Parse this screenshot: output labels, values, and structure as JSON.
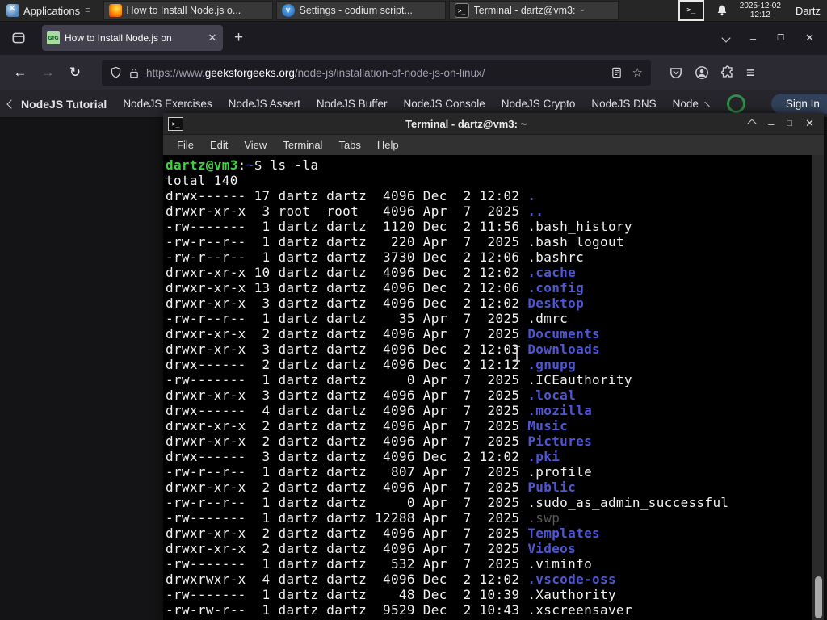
{
  "panel": {
    "applications_label": "Applications",
    "windows": [
      {
        "label": "How to Install Node.js o...",
        "icon": "firefox"
      },
      {
        "label": "Settings - codium script...",
        "icon": "codium"
      },
      {
        "label": "Terminal - dartz@vm3: ~",
        "icon": "terminal"
      }
    ],
    "tray_icons": [
      "terminal-tray-icon",
      "notification-bell-icon"
    ],
    "clock_date": "2025-12-02",
    "clock_time": "12:12",
    "user": "Dartz"
  },
  "browser": {
    "tab": {
      "title": "How to Install Node.js on",
      "favicon": "geeksforgeeks",
      "close_glyph": "✕"
    },
    "new_tab_glyph": "+",
    "window_controls": [
      "tab-list-chevron",
      "minimize",
      "maximize",
      "close"
    ],
    "toolbar_icons_left": [
      "back-arrow",
      "forward-arrow",
      "reload"
    ],
    "toolbar_glyphs": {
      "back": "←",
      "forward": "→",
      "reload": "↻",
      "minimize": "–",
      "maximize": "□",
      "close": "✕"
    },
    "urlbar": {
      "leading_icons": [
        "shield-icon",
        "lock-icon"
      ],
      "url_prefix": "https://www.",
      "url_domain": "geeksforgeeks.org",
      "url_path": "/node-js/installation-of-node-js-on-linux/",
      "trailing_icons": [
        "reader-view-icon",
        "bookmark-star-icon"
      ],
      "star_glyph": "☆"
    },
    "toolbar_icons_right": [
      "pocket-icon",
      "account-icon",
      "extensions-icon",
      "menu-icon"
    ],
    "menu_glyph": "≡"
  },
  "gfg_nav": {
    "links": [
      "NodeJS Tutorial",
      "NodeJS Exercises",
      "NodeJS Assert",
      "NodeJS Buffer",
      "NodeJS Console",
      "NodeJS Crypto",
      "NodeJS DNS",
      "Node"
    ],
    "search_icon": "search-magnifier",
    "sign_in_label": "Sign In"
  },
  "terminal": {
    "title": "Terminal - dartz@vm3: ~",
    "window_controls": [
      "shade",
      "minimize",
      "maximize",
      "close"
    ],
    "menu": [
      "File",
      "Edit",
      "View",
      "Terminal",
      "Tabs",
      "Help"
    ],
    "prompt": {
      "user": "dartz@vm3",
      "colon": ":",
      "path": "~",
      "rest": "$ ls -la"
    },
    "total_line": "total 140",
    "rows": [
      {
        "pre": "drwx------ 17 dartz dartz  4096 Dec  2 12:02 ",
        "name": ".",
        "kind": "dir"
      },
      {
        "pre": "drwxr-xr-x  3 root  root   4096 Apr  7  2025 ",
        "name": "..",
        "kind": "dir"
      },
      {
        "pre": "-rw-------  1 dartz dartz  1120 Dec  2 11:56 ",
        "name": ".bash_history",
        "kind": "file"
      },
      {
        "pre": "-rw-r--r--  1 dartz dartz   220 Apr  7  2025 ",
        "name": ".bash_logout",
        "kind": "file"
      },
      {
        "pre": "-rw-r--r--  1 dartz dartz  3730 Dec  2 12:06 ",
        "name": ".bashrc",
        "kind": "file"
      },
      {
        "pre": "drwxr-xr-x 10 dartz dartz  4096 Dec  2 12:02 ",
        "name": ".cache",
        "kind": "dir"
      },
      {
        "pre": "drwxr-xr-x 13 dartz dartz  4096 Dec  2 12:06 ",
        "name": ".config",
        "kind": "dir"
      },
      {
        "pre": "drwxr-xr-x  3 dartz dartz  4096 Dec  2 12:02 ",
        "name": "Desktop",
        "kind": "dir"
      },
      {
        "pre": "-rw-r--r--  1 dartz dartz    35 Apr  7  2025 ",
        "name": ".dmrc",
        "kind": "file"
      },
      {
        "pre": "drwxr-xr-x  2 dartz dartz  4096 Apr  7  2025 ",
        "name": "Documents",
        "kind": "dir"
      },
      {
        "pre": "drwxr-xr-x  3 dartz dartz  4096 Dec  2 12:03 ",
        "name": "Downloads",
        "kind": "dir"
      },
      {
        "pre": "drwx------  2 dartz dartz  4096 Dec  2 12:12 ",
        "name": ".gnupg",
        "kind": "dir"
      },
      {
        "pre": "-rw-------  1 dartz dartz     0 Apr  7  2025 ",
        "name": ".ICEauthority",
        "kind": "file"
      },
      {
        "pre": "drwxr-xr-x  3 dartz dartz  4096 Apr  7  2025 ",
        "name": ".local",
        "kind": "dir"
      },
      {
        "pre": "drwx------  4 dartz dartz  4096 Apr  7  2025 ",
        "name": ".mozilla",
        "kind": "dir"
      },
      {
        "pre": "drwxr-xr-x  2 dartz dartz  4096 Apr  7  2025 ",
        "name": "Music",
        "kind": "dir"
      },
      {
        "pre": "drwxr-xr-x  2 dartz dartz  4096 Apr  7  2025 ",
        "name": "Pictures",
        "kind": "dir"
      },
      {
        "pre": "drwx------  3 dartz dartz  4096 Dec  2 12:02 ",
        "name": ".pki",
        "kind": "dir"
      },
      {
        "pre": "-rw-r--r--  1 dartz dartz   807 Apr  7  2025 ",
        "name": ".profile",
        "kind": "file"
      },
      {
        "pre": "drwxr-xr-x  2 dartz dartz  4096 Apr  7  2025 ",
        "name": "Public",
        "kind": "dir"
      },
      {
        "pre": "-rw-r--r--  1 dartz dartz     0 Apr  7  2025 ",
        "name": ".sudo_as_admin_successful",
        "kind": "file"
      },
      {
        "pre": "-rw-------  1 dartz dartz 12288 Apr  7  2025 ",
        "name": ".swp",
        "kind": "dim"
      },
      {
        "pre": "drwxr-xr-x  2 dartz dartz  4096 Apr  7  2025 ",
        "name": "Templates",
        "kind": "dir"
      },
      {
        "pre": "drwxr-xr-x  2 dartz dartz  4096 Apr  7  2025 ",
        "name": "Videos",
        "kind": "dir"
      },
      {
        "pre": "-rw-------  1 dartz dartz   532 Apr  7  2025 ",
        "name": ".viminfo",
        "kind": "file"
      },
      {
        "pre": "drwxrwxr-x  4 dartz dartz  4096 Dec  2 12:02 ",
        "name": ".vscode-oss",
        "kind": "dir"
      },
      {
        "pre": "-rw-------  1 dartz dartz    48 Dec  2 10:39 ",
        "name": ".Xauthority",
        "kind": "file"
      },
      {
        "pre": "-rw-rw-r--  1 dartz dartz  9529 Dec  2 10:43 ",
        "name": ".xscreensaver",
        "kind": "file"
      }
    ]
  },
  "colors": {
    "dir_blue": "#4e56d4",
    "prompt_green": "#3fd23f",
    "gfg_green": "#2f8d46",
    "signin_bg": "#32415a",
    "terminal_bg": "#000000",
    "firefox_toolbar": "#2b2a33",
    "tab_active": "#42414d"
  }
}
